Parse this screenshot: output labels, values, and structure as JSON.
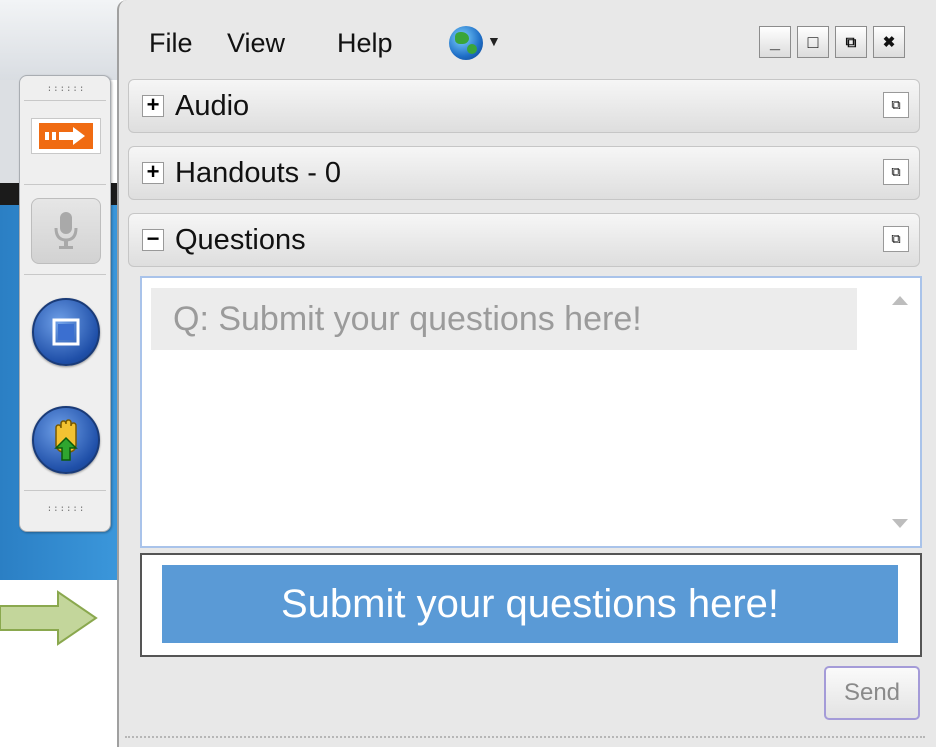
{
  "menu": {
    "file": "File",
    "view": "View",
    "help": "Help"
  },
  "window_controls": {
    "minimize": "_",
    "maximize": "□",
    "restore": "⧉",
    "close": "✖"
  },
  "sections": [
    {
      "toggle": "+",
      "title": "Audio"
    },
    {
      "toggle": "+",
      "title": "Handouts - 0"
    },
    {
      "toggle": "−",
      "title": "Questions"
    }
  ],
  "questions": {
    "log_placeholder": "Q: Submit your questions here!",
    "input_text": "Submit your questions here!",
    "send_label": "Send"
  },
  "colors": {
    "input_fill": "#5a9ad6",
    "arrow_fill": "#c3d69b",
    "arrow_stroke": "#8aa84e"
  }
}
